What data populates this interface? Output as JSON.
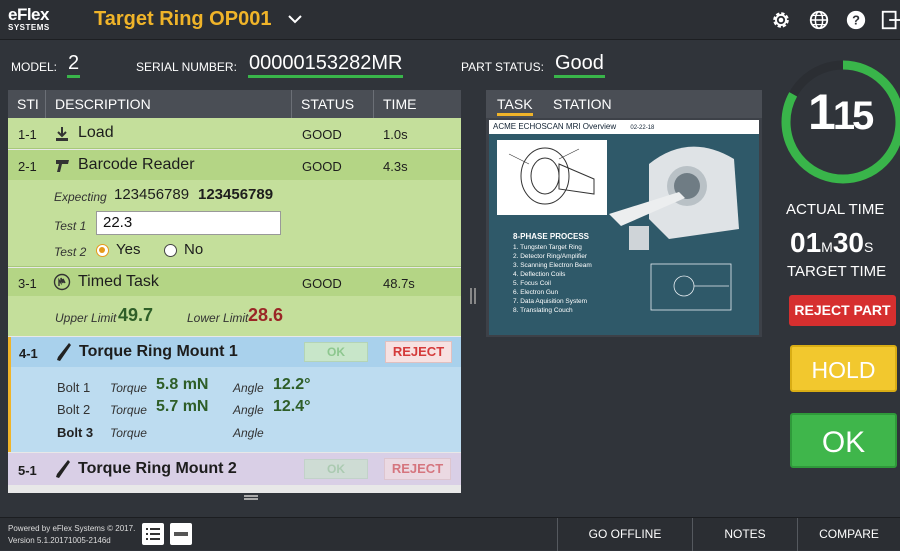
{
  "app": {
    "logo_line1": "eFlex",
    "logo_line2": "SYSTEMS",
    "title": "Target Ring OP001"
  },
  "header_icons": [
    "gear-icon",
    "globe-icon",
    "help-icon",
    "exit-icon"
  ],
  "info": {
    "model_label": "MODEL:",
    "model_value": "2",
    "serial_label": "SERIAL NUMBER:",
    "serial_value": "00000153282MR",
    "part_status_label": "PART STATUS:",
    "part_status_value": "Good"
  },
  "steps_table": {
    "columns": [
      "STI",
      "DESCRIPTION",
      "STATUS",
      "TIME"
    ],
    "steps": [
      {
        "num": "1-1",
        "desc": "Load",
        "icon": "download-icon",
        "status": "GOOD",
        "time": "1.0s"
      },
      {
        "num": "2-1",
        "desc": "Barcode Reader",
        "icon": "barcode-gun-icon",
        "status": "GOOD",
        "time": "4.3s"
      },
      {
        "num": "3-1",
        "desc": "Timed Task",
        "icon": "hand-icon",
        "status": "GOOD",
        "time": "48.7s"
      },
      {
        "num": "4-1",
        "desc": "Torque Ring Mount 1",
        "icon": "wrench-icon",
        "ok": "OK",
        "reject": "REJECT"
      },
      {
        "num": "5-1",
        "desc": "Torque Ring Mount 2",
        "icon": "wrench-icon",
        "ok": "OK",
        "reject": "REJECT"
      }
    ],
    "barcode": {
      "expecting_label": "Expecting",
      "expected": "123456789",
      "scanned": "123456789",
      "test1_label": "Test 1",
      "test1_value": "22.3",
      "test2_label": "Test 2",
      "yes_label": "Yes",
      "no_label": "No",
      "selected": "Yes"
    },
    "timed": {
      "upper_label": "Upper Limit",
      "upper_value": "49.7",
      "lower_label": "Lower Limit",
      "lower_value": "28.6"
    },
    "torque": {
      "torque_label": "Torque",
      "angle_label": "Angle",
      "bolts": [
        {
          "name": "Bolt 1",
          "torque": "5.8 mN",
          "angle": "12.2°"
        },
        {
          "name": "Bolt 2",
          "torque": "5.7 mN",
          "angle": "12.4°"
        },
        {
          "name": "Bolt 3",
          "torque": "",
          "angle": ""
        }
      ]
    }
  },
  "task_panel": {
    "tab_task": "TASK",
    "tab_station": "STATION",
    "doc_title": "ACME ECHOSCAN MRI Overview",
    "doc_date": "02-22-18",
    "process_title": "8-PHASE PROCESS",
    "process_items": [
      "1. Tungsten Target Ring",
      "2. Detector Ring/Amplifier",
      "3. Scanning Electron Beam",
      "4. Deflection Coils",
      "5. Focus Coil",
      "6. Electron Gun",
      "7. Data Aquisition System",
      "8. Translating Couch"
    ]
  },
  "timer": {
    "value_major": "1",
    "value_minor": "15",
    "actual_label": "ACTUAL TIME",
    "target_min": "01",
    "target_min_unit": "M",
    "target_sec": "30",
    "target_sec_unit": "S",
    "target_label": "TARGET TIME",
    "progress_fraction": 0.83
  },
  "actions": {
    "reject_part": "REJECT PART",
    "hold": "HOLD",
    "ok": "OK"
  },
  "footer": {
    "powered": "Powered by eFlex Systems © 2017.",
    "version": "Version 5.1.20171005-2146d",
    "go_offline": "GO OFFLINE",
    "notes": "NOTES",
    "compare": "COMPARE"
  },
  "colors": {
    "accent_title": "#f0b429",
    "good_green": "#39b54a",
    "reject_red": "#d62f2f",
    "hold_yellow": "#f2c82e"
  }
}
